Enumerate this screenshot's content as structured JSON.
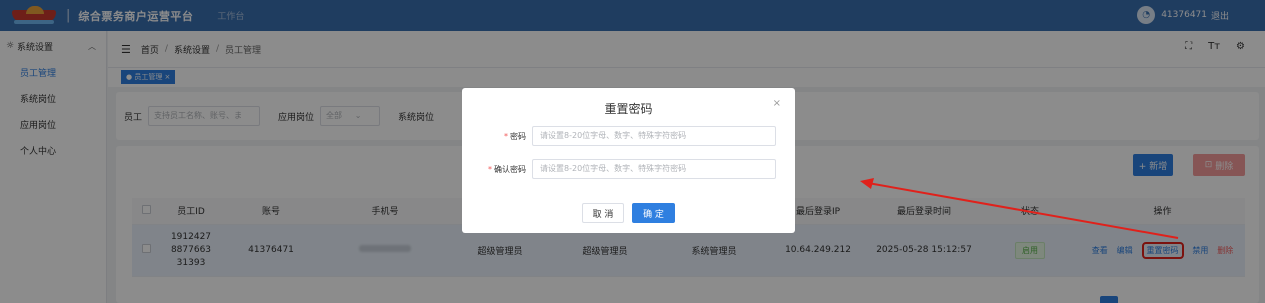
{
  "topbar": {
    "app_title": "综合票务商户运营平台",
    "separator": "|",
    "workbench": "工作台",
    "user_id": "41376471",
    "logout": "退出"
  },
  "sidebar": {
    "group_label": "系统设置",
    "items": [
      {
        "label": "员工管理",
        "active": true
      },
      {
        "label": "系统岗位",
        "active": false
      },
      {
        "label": "应用岗位",
        "active": false
      },
      {
        "label": "个人中心",
        "active": false
      }
    ]
  },
  "breadcrumb": {
    "home": "首页",
    "section": "系统设置",
    "current": "员工管理"
  },
  "tags": {
    "active_tag": "● 员工管理 ×"
  },
  "search": {
    "employee_label": "员工",
    "employee_placeholder": "支持员工名称、账号、ま",
    "app_post_label": "应用岗位",
    "app_post_value": "全部",
    "sys_post_label": "系统岗位"
  },
  "toolbar": {
    "add_label": "+ 新增",
    "delete_label": "删除"
  },
  "table": {
    "headers": [
      "员工ID",
      "账号",
      "手机号",
      "",
      "",
      "",
      "最后登录IP",
      "最后登录时间",
      "状态",
      "操作"
    ],
    "row": {
      "id_line1": "1912427",
      "id_line2": "8877663",
      "id_line3": "31393",
      "account": "41376471",
      "col4": "超级管理员",
      "col5": "超级管理员",
      "col6": "系统管理员",
      "ip": "10.64.249.212",
      "time": "2025-05-28 15:12:57",
      "status": "启用",
      "actions": {
        "view": "查看",
        "edit": "编辑",
        "reset": "重置密码",
        "disable": "禁用",
        "delete": "删除"
      }
    }
  },
  "modal": {
    "title": "重置密码",
    "close": "×",
    "password_label": "密码",
    "password_placeholder": "请设置8-20位字母、数字、特殊字符密码",
    "confirm_label": "确认密码",
    "confirm_placeholder": "请设置8-20位字母、数字、特殊字符密码",
    "cancel": "取 消",
    "ok": "确 定"
  },
  "colors": {
    "topbar": "#3a6fb0",
    "primary": "#2f7fe0",
    "annotation": "#e0211b"
  }
}
